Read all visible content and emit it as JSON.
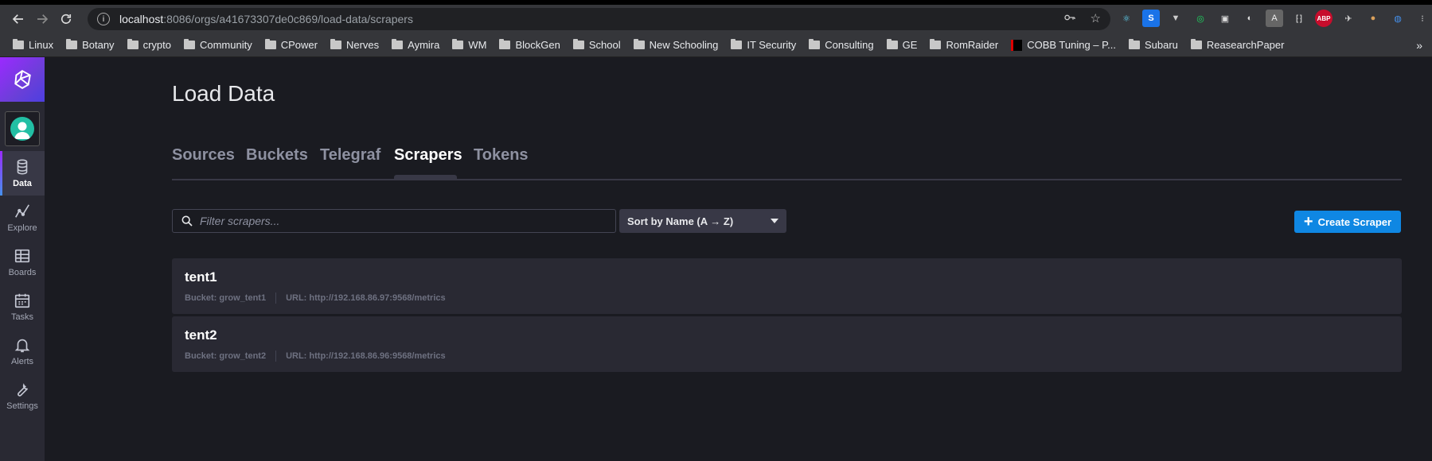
{
  "browser": {
    "url_host": "localhost",
    "url_rest": ":8086/orgs/a41673307de0c869/load-data/scrapers",
    "bookmarks": [
      "Linux",
      "Botany",
      "crypto",
      "Community",
      "CPower",
      "Nerves",
      "Aymira",
      "WM",
      "BlockGen",
      "School",
      "New Schooling",
      "IT Security",
      "Consulting",
      "GE",
      "RomRaider",
      "COBB Tuning – P...",
      "Subaru",
      "ReasearchPaper"
    ],
    "bookmarks_more": "»",
    "extension_labels": [
      "S",
      "A",
      "ABP"
    ]
  },
  "sidebar": {
    "items": [
      {
        "label": "Data",
        "icon": "database-icon",
        "active": true
      },
      {
        "label": "Explore",
        "icon": "graph-icon",
        "active": false
      },
      {
        "label": "Boards",
        "icon": "dashboard-grid-icon",
        "active": false
      },
      {
        "label": "Tasks",
        "icon": "calendar-icon",
        "active": false
      },
      {
        "label": "Alerts",
        "icon": "bell-icon",
        "active": false
      },
      {
        "label": "Settings",
        "icon": "wrench-icon",
        "active": false
      }
    ]
  },
  "page": {
    "title": "Load Data",
    "tabs": [
      {
        "label": "Sources",
        "active": false
      },
      {
        "label": "Buckets",
        "active": false
      },
      {
        "label": "Telegraf",
        "active": false
      },
      {
        "label": "Scrapers",
        "active": true
      },
      {
        "label": "Tokens",
        "active": false
      }
    ]
  },
  "controls": {
    "search_placeholder": "Filter scrapers...",
    "sort_label": "Sort by Name (A → Z)",
    "create_label": "Create Scraper"
  },
  "scrapers": [
    {
      "name": "tent1",
      "bucket": "Bucket: grow_tent1",
      "url": "URL: http://192.168.86.97:9568/metrics"
    },
    {
      "name": "tent2",
      "bucket": "Bucket: grow_tent2",
      "url": "URL: http://192.168.86.96:9568/metrics"
    }
  ],
  "colors": {
    "accent": "#0f87e3",
    "background": "#1a1b21",
    "card": "#292933"
  }
}
